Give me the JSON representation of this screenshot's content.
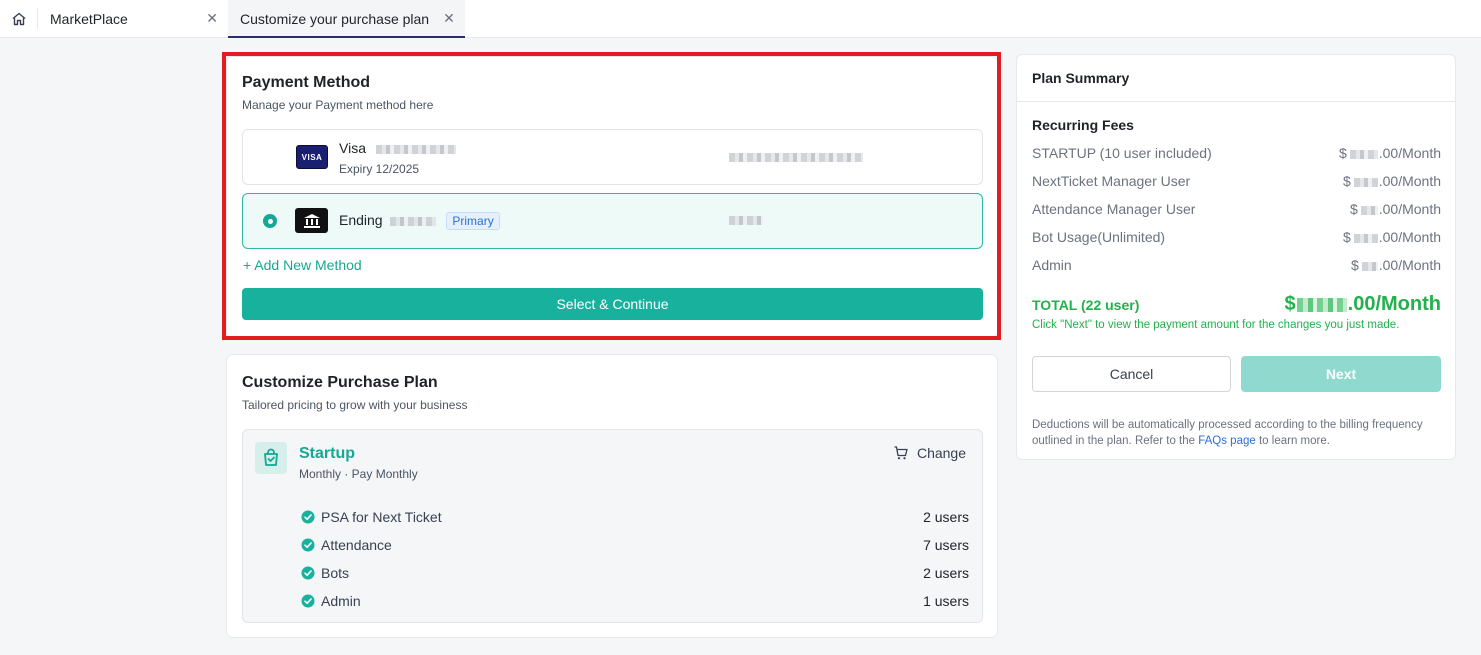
{
  "tabs": [
    {
      "label": "MarketPlace",
      "close": "✕"
    },
    {
      "label": "Customize your purchase plan",
      "close": "✕"
    }
  ],
  "payment": {
    "title": "Payment Method",
    "subtitle": "Manage your Payment method here",
    "methods": [
      {
        "name": "Visa",
        "logo_text": "VISA",
        "expiry": "Expiry 12/2025"
      },
      {
        "name": "Ending",
        "badge": "Primary"
      }
    ],
    "add_label": "+ Add New Method",
    "select_label": "Select & Continue"
  },
  "plan": {
    "title": "Customize Purchase Plan",
    "subtitle": "Tailored pricing to grow with your business",
    "name": "Startup",
    "frequency": "Monthly · Pay Monthly",
    "change_label": "Change",
    "features": [
      {
        "name": "PSA for Next Ticket",
        "value": "2 users"
      },
      {
        "name": "Attendance",
        "value": "7 users"
      },
      {
        "name": "Bots",
        "value": "2 users"
      },
      {
        "name": "Admin",
        "value": "1 users"
      }
    ]
  },
  "summary": {
    "title": "Plan Summary",
    "recurring_title": "Recurring Fees",
    "fees": [
      {
        "name": "STARTUP (10 user included)",
        "prefix": "$",
        "suffix": ".00/Month"
      },
      {
        "name": "NextTicket Manager User",
        "prefix": "$",
        "suffix": ".00/Month"
      },
      {
        "name": "Attendance Manager User",
        "prefix": "$",
        "suffix": ".00/Month"
      },
      {
        "name": "Bot Usage(Unlimited)",
        "prefix": "$",
        "suffix": ".00/Month"
      },
      {
        "name": "Admin",
        "prefix": "$",
        "suffix": ".00/Month"
      }
    ],
    "total_label": "TOTAL (22 user)",
    "total_prefix": "$",
    "total_suffix": ".00/Month",
    "total_note": "Click \"Next\" to view the payment amount for the changes you just made.",
    "cancel_label": "Cancel",
    "next_label": "Next",
    "note_before": "Deductions will be automatically processed according to the billing frequency outlined in the plan. Refer to the ",
    "note_link": "FAQs page",
    "note_after": " to learn more."
  },
  "colors": {
    "accent": "#18b19e",
    "highlight": "#e11d23",
    "total": "#22b14c"
  }
}
